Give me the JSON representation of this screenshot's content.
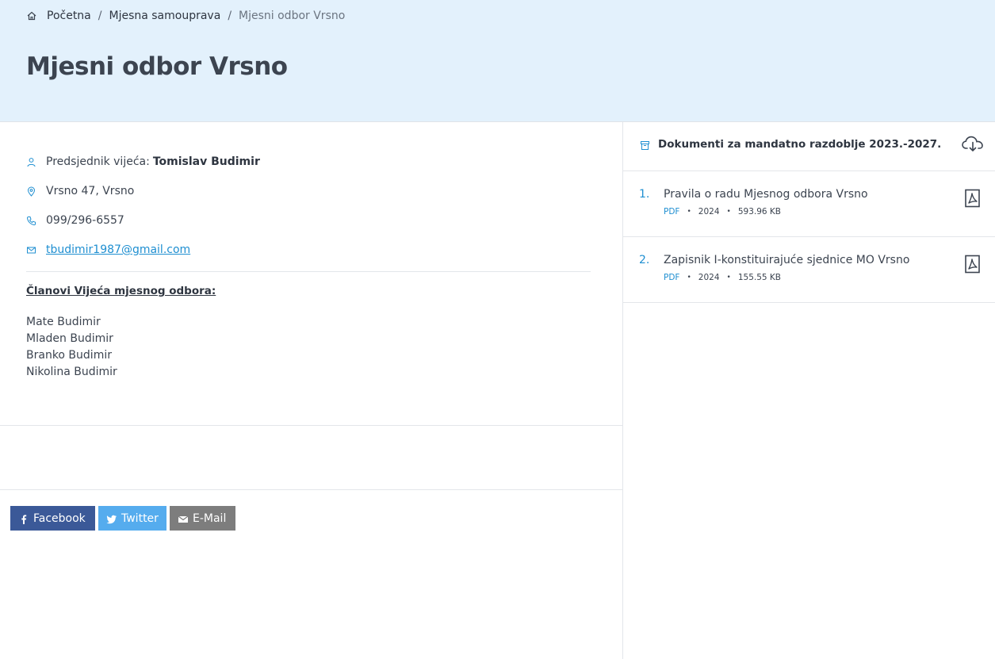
{
  "breadcrumb": {
    "home": "Početna",
    "parent": "Mjesna samouprava",
    "current": "Mjesni odbor Vrsno",
    "separator": "/"
  },
  "page": {
    "title": "Mjesni odbor Vrsno"
  },
  "info": {
    "president_label": "Predsjednik vijeća:",
    "president_name": "Tomislav Budimir",
    "address": "Vrsno 47, Vrsno",
    "phone": "099/296-6557",
    "email": "tbudimir1987@gmail.com"
  },
  "members": {
    "title": "Članovi Vijeća mjesnog odbora:",
    "list": [
      "Mate Budimir",
      "Mladen Budimir",
      "Branko Budimir",
      "Nikolina Budimir"
    ]
  },
  "share": {
    "facebook": "Facebook",
    "twitter": "Twitter",
    "email": "E-Mail"
  },
  "documents": {
    "title": "Dokumenti za mandatno razdoblje 2023.-2027.",
    "items": [
      {
        "num": "1.",
        "name": "Pravila o radu Mjesnog odbora Vrsno",
        "type": "PDF",
        "year": "2024",
        "size": "593.96 KB"
      },
      {
        "num": "2.",
        "name": "Zapisnik I-konstituirajuće sjednice MO Vrsno",
        "type": "PDF",
        "year": "2024",
        "size": "155.55 KB"
      }
    ]
  },
  "colors": {
    "hero_bg": "#e3f1fc",
    "accent": "#1f8fd1",
    "facebook": "#3b5998",
    "twitter": "#55acee",
    "email": "#7d7d7d"
  }
}
